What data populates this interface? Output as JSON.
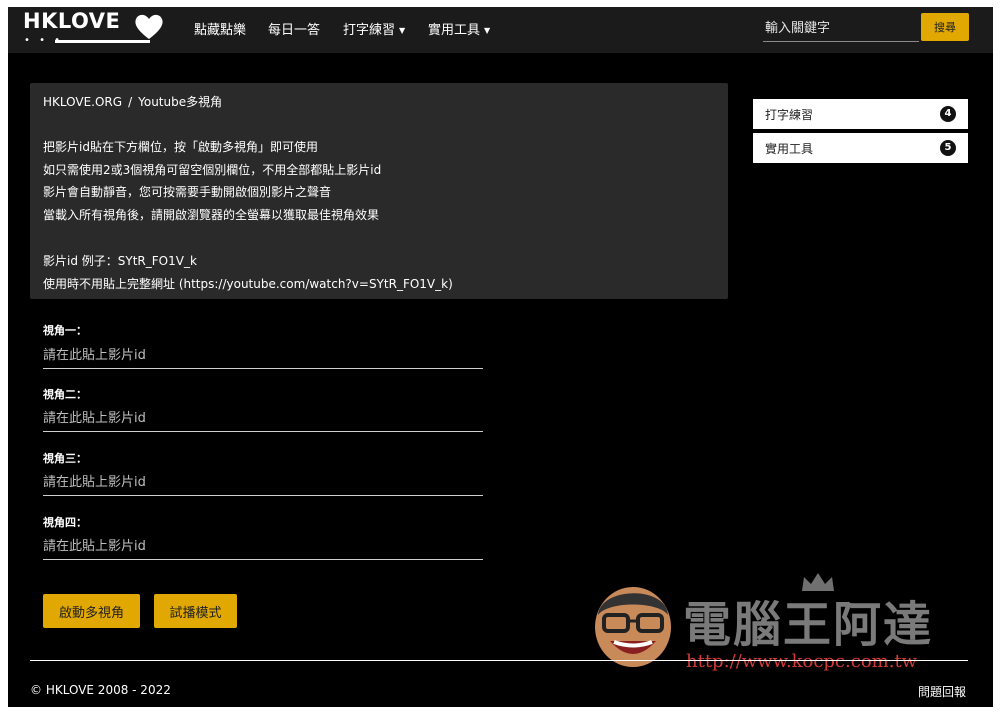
{
  "navbar": {
    "brand": "HKLOVE",
    "brand_dots": "• • •",
    "items": [
      {
        "label": "點藏點樂",
        "has_dropdown": false
      },
      {
        "label": "每日一答",
        "has_dropdown": false
      },
      {
        "label": "打字練習",
        "has_dropdown": true
      },
      {
        "label": "實用工具",
        "has_dropdown": true
      }
    ],
    "search_placeholder": "輸入關鍵字",
    "search_button": "搜尋"
  },
  "breadcrumb": {
    "home": "HKLOVE.ORG",
    "separator": "/",
    "current": "Youtube多視角"
  },
  "instructions": [
    "把影片id貼在下方欄位，按「啟動多視角」即可使用",
    "如只需使用2或3個視角可留空個別欄位，不用全部都貼上影片id",
    "影片會自動靜音，您可按需要手動開啟個別影片之聲音",
    "當載入所有視角後，請開啟瀏覽器的全螢幕以獲取最佳視角效果",
    "影片id 例子：SYtR_FO1V_k",
    "使用時不用貼上完整網址 (https://youtube.com/watch?v=SYtR_FO1V_k)"
  ],
  "fields": [
    {
      "label": "視角一：",
      "placeholder": "請在此貼上影片id"
    },
    {
      "label": "視角二：",
      "placeholder": "請在此貼上影片id"
    },
    {
      "label": "視角三：",
      "placeholder": "請在此貼上影片id"
    },
    {
      "label": "視角四：",
      "placeholder": "請在此貼上影片id"
    }
  ],
  "buttons": {
    "start": "啟動多視角",
    "trial": "試播模式"
  },
  "sidebar": [
    {
      "label": "打字練習",
      "count": "4"
    },
    {
      "label": "實用工具",
      "count": "5"
    }
  ],
  "watermark": {
    "title": "電腦王阿達",
    "url": "http://www.kocpc.com.tw"
  },
  "footer": {
    "copyright": "© HKLOVE 2008 - 2022",
    "link": "問題回報"
  },
  "colors": {
    "accent": "#e0a800",
    "page_bg": "#000000",
    "navbar_bg": "#1b1b1b",
    "panel_bg": "#2a2a2a"
  }
}
